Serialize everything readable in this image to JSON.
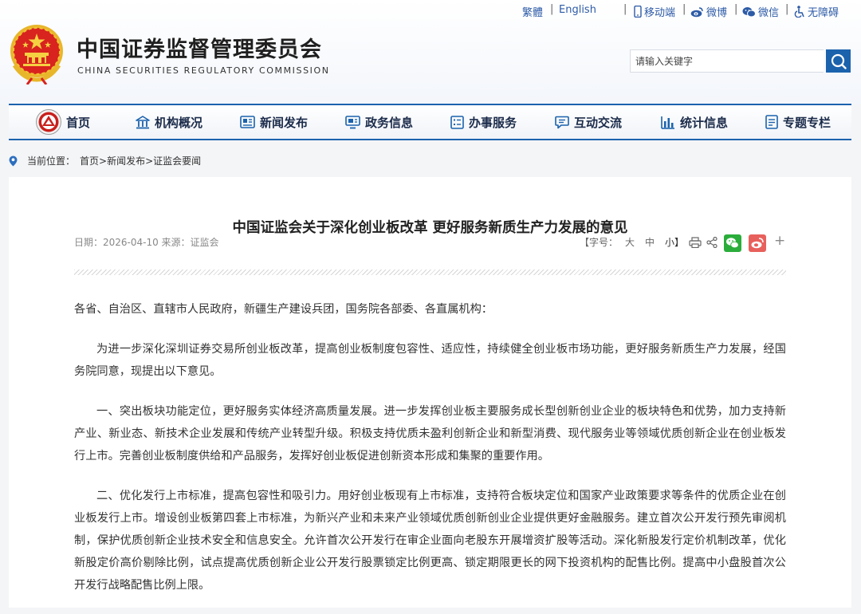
{
  "header": {
    "site_name_cn": "中国证券监督管理委员会",
    "site_name_en": "CHINA SECURITIES REGULATORY COMMISSION",
    "top_links": {
      "traditional": "繁體",
      "english": "English",
      "mobile": "移动端",
      "weibo": "微博",
      "wechat": "微信",
      "accessibility": "无障碍",
      "separator": "|"
    },
    "search": {
      "placeholder": "请输入关键字",
      "value": ""
    }
  },
  "nav": {
    "items": [
      {
        "label": "首页",
        "icon": "csrc-logo-icon"
      },
      {
        "label": "机构概况",
        "icon": "building-icon"
      },
      {
        "label": "新闻发布",
        "icon": "newspaper-icon"
      },
      {
        "label": "政务信息",
        "icon": "monitor-icon"
      },
      {
        "label": "办事服务",
        "icon": "list-icon"
      },
      {
        "label": "互动交流",
        "icon": "chat-icon"
      },
      {
        "label": "统计信息",
        "icon": "bar-chart-icon"
      },
      {
        "label": "专题专栏",
        "icon": "document-icon"
      }
    ]
  },
  "breadcrumb": {
    "prefix": "当前位置：",
    "path": "首页>新闻发布>证监会要闻"
  },
  "article": {
    "title": "中国证监会关于深化创业板改革 更好服务新质生产力发展的意见",
    "meta": "日期：2026-04-10  来源：证监会",
    "font_size_label": "【字号：",
    "size_large": "大",
    "size_medium": "中",
    "size_small": "小】",
    "plus": "+",
    "paragraphs": [
      "各省、自治区、直辖市人民政府，新疆生产建设兵团，国务院各部委、各直属机构：",
      "为进一步深化深圳证券交易所创业板改革，提高创业板制度包容性、适应性，持续健全创业板市场功能，更好服务新质生产力发展，经国务院同意，现提出以下意见。",
      "一、突出板块功能定位，更好服务实体经济高质量发展。进一步发挥创业板主要服务成长型创新创业企业的板块特色和优势，加力支持新产业、新业态、新技术企业发展和传统产业转型升级。积极支持优质未盈利创新企业和新型消费、现代服务业等领域优质创新企业在创业板发行上市。完善创业板制度供给和产品服务，发挥好创业板促进创新资本形成和集聚的重要作用。",
      "二、优化发行上市标准，提高包容性和吸引力。用好创业板现有上市标准，支持符合板块定位和国家产业政策要求等条件的优质企业在创业板发行上市。增设创业板第四套上市标准，为新兴产业和未来产业领域优质创新创业企业提供更好金融服务。建立首次公开发行预先审阅机制，保护优质创新企业技术安全和信息安全。允许首次公开发行在审企业面向老股东开展增资扩股等活动。深化新股发行定价机制改革，优化新股定价高价剔除比例，试点提高优质创新企业公开发行股票锁定比例更高、锁定期限更长的网下投资机构的配售比例。提高中小盘股首次公开发行战略配售比例上限。"
    ]
  },
  "colors": {
    "brand_blue": "#1b62ad",
    "link_blue": "#2d5ba6",
    "wechat_green": "#2bad3b",
    "weibo_red": "#e8605c",
    "emblem_red": "#d8231f",
    "emblem_gold": "#f1c232"
  }
}
